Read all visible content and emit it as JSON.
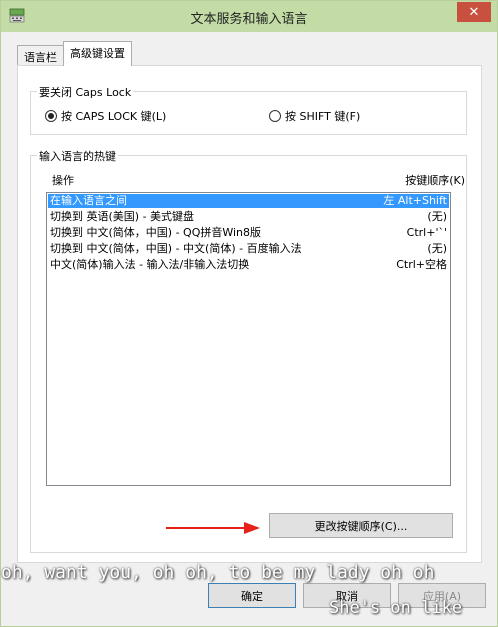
{
  "window": {
    "title": "文本服务和输入语言",
    "close_label": "✕"
  },
  "tabs": [
    {
      "label": "语言栏"
    },
    {
      "label": "高级键设置"
    }
  ],
  "caps": {
    "label": "要关闭 Caps Lock",
    "option1": "按 CAPS LOCK 键(L)",
    "option2": "按 SHIFT 键(F)",
    "selected": 1
  },
  "hotkeys": {
    "label": "输入语言的热键",
    "col_action": "操作",
    "col_sequence": "按键顺序(K)",
    "rows": [
      {
        "action": "在输入语言之间",
        "keys": "左 Alt+Shift",
        "selected": true
      },
      {
        "action": "切换到 英语(美国) - 美式键盘",
        "keys": "(无)"
      },
      {
        "action": "切换到 中文(简体，中国) - QQ拼音Win8版",
        "keys": "Ctrl+'`'"
      },
      {
        "action": "切换到 中文(简体，中国) - 中文(简体) - 百度输入法",
        "keys": "(无)"
      },
      {
        "action": "中文(简体)输入法 - 输入法/非输入法切换",
        "keys": "Ctrl+空格"
      }
    ],
    "change_button": "更改按键顺序(C)..."
  },
  "footer": {
    "ok": "确定",
    "cancel": "取消",
    "apply": "应用(A)"
  },
  "overlay": {
    "line1": "oh, want you, oh oh, to be my lady oh oh",
    "line2": "She's on like"
  },
  "colors": {
    "titlebar": "#c3dca6",
    "close": "#c7503f",
    "selection": "#3399ff",
    "arrow": "#e8201a"
  }
}
